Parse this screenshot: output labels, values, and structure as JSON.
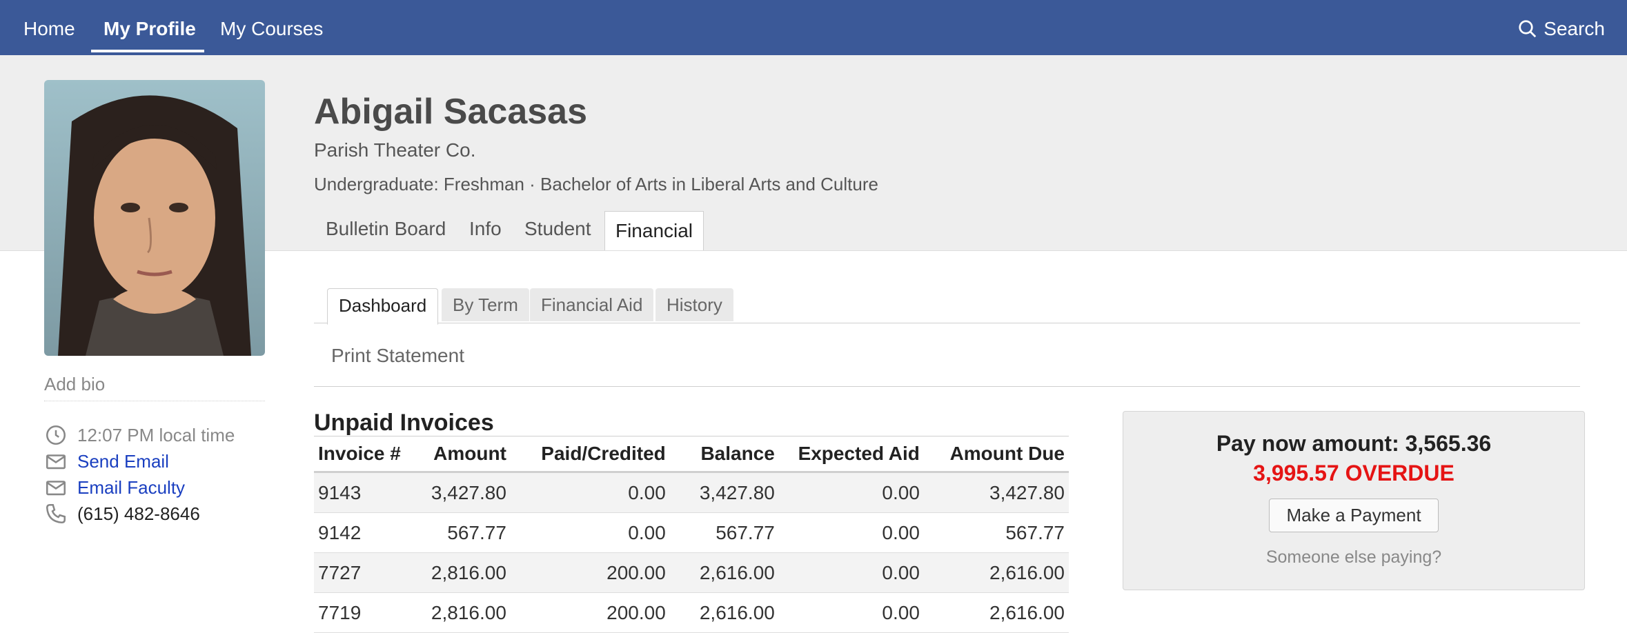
{
  "nav": {
    "items": [
      {
        "label": "Home"
      },
      {
        "label": "My Profile"
      },
      {
        "label": "My Courses"
      }
    ],
    "active_index": 1,
    "search_label": "Search",
    "accent": "#3b5998"
  },
  "profile": {
    "name": "Abigail Sacasas",
    "organization": "Parish Theater Co.",
    "program": "Undergraduate: Freshman · Bachelor of Arts in Liberal Arts and Culture",
    "add_bio": "Add bio",
    "local_time": "12:07 PM local time",
    "send_email": "Send Email",
    "email_faculty": "Email Faculty",
    "phone": "(615) 482-8646"
  },
  "profile_tabs": [
    {
      "label": "Bulletin Board"
    },
    {
      "label": "Info"
    },
    {
      "label": "Student"
    },
    {
      "label": "Financial"
    }
  ],
  "financial_tabs": [
    {
      "label": "Dashboard"
    },
    {
      "label": "By Term"
    },
    {
      "label": "Financial Aid"
    },
    {
      "label": "History"
    }
  ],
  "print_statement": "Print Statement",
  "invoices": {
    "title": "Unpaid Invoices",
    "columns": [
      "Invoice #",
      "Amount",
      "Paid/Credited",
      "Balance",
      "Expected Aid",
      "Amount Due"
    ],
    "rows": [
      [
        "9143",
        "3,427.80",
        "0.00",
        "3,427.80",
        "0.00",
        "3,427.80"
      ],
      [
        "9142",
        "567.77",
        "0.00",
        "567.77",
        "0.00",
        "567.77"
      ],
      [
        "7727",
        "2,816.00",
        "200.00",
        "2,616.00",
        "0.00",
        "2,616.00"
      ],
      [
        "7719",
        "2,816.00",
        "200.00",
        "2,616.00",
        "0.00",
        "2,616.00"
      ]
    ]
  },
  "payment": {
    "pay_now": "Pay now amount: 3,565.36",
    "overdue": "3,995.57 OVERDUE",
    "button": "Make a Payment",
    "someone_else": "Someone else paying?",
    "overdue_color": "#e51414"
  }
}
